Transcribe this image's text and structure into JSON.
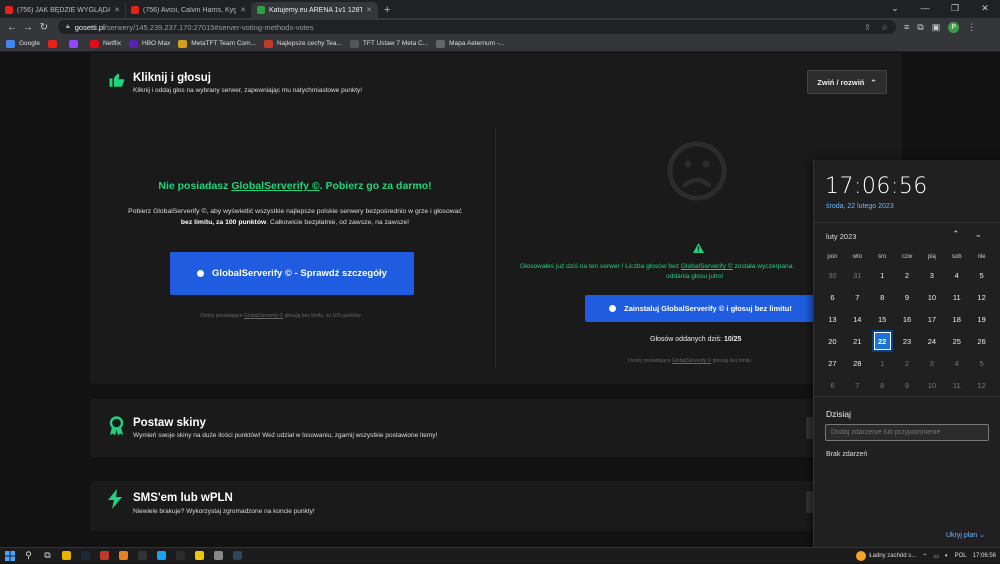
{
  "browser": {
    "tabs": [
      {
        "title": "(756) JAK BĘDZIE WYGLĄDAŁ M...",
        "icon_color": "#e62117",
        "active": false
      },
      {
        "title": "(756) Avicii, Calvin Harris, Kyg...",
        "icon_color": "#e62117",
        "active": false
      },
      {
        "title": "Katujemy.eu ARENA 1v1 128TR I...",
        "icon_color": "#2ea043",
        "active": true
      }
    ],
    "new_tab": "+",
    "window_controls": [
      "⌄",
      "—",
      "❐",
      "✕"
    ],
    "nav": {
      "back": "←",
      "forward": "→",
      "reload": "↻"
    },
    "url_host": "gosetti.pl",
    "url_path": "/serwery/145.239.237.170:27015#server-voting-methods-votes",
    "profile_letter": "P",
    "bookmarks": [
      {
        "label": "Google",
        "icon_color": "#4285f4"
      },
      {
        "label": "",
        "icon_color": "#e62117"
      },
      {
        "label": "",
        "icon_color": "#9146ff"
      },
      {
        "label": "Netflix",
        "icon_color": "#e50914"
      },
      {
        "label": "HBO Max",
        "icon_color": "#5822b4"
      },
      {
        "label": "MetaTFT Team Com...",
        "icon_color": "#d4a017"
      },
      {
        "label": "Najlepsze cechy Tea...",
        "icon_color": "#c0392b"
      },
      {
        "label": "TFT Ustaw 7 Meta C...",
        "icon_color": "#555"
      },
      {
        "label": "Mapa Aeternum -...",
        "icon_color": "#666"
      }
    ]
  },
  "vote_section": {
    "title": "Kliknij i głosuj",
    "subtitle": "Kliknij i oddaj głos na wybrany serwer, zapewniając mu natychmiastowe punkty!",
    "collapse_label": "Zwiń / rozwiń",
    "left": {
      "headline_pre": "Nie posiadasz ",
      "headline_link": "GlobalServerify ©",
      "headline_post": ". Pobierz go za darmo!",
      "desc_line1": "Pobierz GlobalServerify ©, aby wyświetlić wszystkie najlepsze polskie serwery bezpośrednio w grze i głosować",
      "desc_bold": "bez limitu, za 100 punktów",
      "desc_line2_post": ". Całkowicie bezpłatnie, od zawsze, na zawsze!",
      "button_label": "GlobalServerify © - Sprawdź szczegóły",
      "note_pre": "Osoby posiadające ",
      "note_link": "GlobalServerify ©",
      "note_post": " głosują bez limitu, za 100 punktów"
    },
    "right": {
      "message_line1_pre": "Głosowałeś już dziś na ten serwer / Liczba głosów bez ",
      "message_line1_link": "GlobalServerify ©",
      "message_line1_post": " została wyczerpana.",
      "message_line2": "oddania głosu jutro!",
      "button_label": "Zainstaluj GlobalServerify © i głosuj bez limitu!",
      "votes_label": "Głosów oddanych dziś: ",
      "votes_value": "10/25",
      "note_pre": "Osoby posiadające ",
      "note_link": "GlobalServerify ©",
      "note_post": " głosują bez limitu"
    }
  },
  "skins_section": {
    "title": "Postaw skiny",
    "subtitle": "Wymień swoje skiny na duże ilości punktów! Weź udział w losowaniu, zgarnij wszystkie postawione itemy!"
  },
  "sms_section": {
    "title": "SMS'em lub wPLN",
    "subtitle": "Niewiele brakuje? Wykorzystaj zgromadzone na koncie punkty!"
  },
  "calendar": {
    "time": "17:06:56",
    "date": "środa, 22 lutego 2023",
    "month": "luty 2023",
    "weekdays": [
      "pon",
      "wto",
      "śro",
      "czw",
      "pią",
      "sob",
      "nie"
    ],
    "weeks": [
      [
        {
          "d": "30",
          "dim": true
        },
        {
          "d": "31",
          "dim": true
        },
        {
          "d": "1"
        },
        {
          "d": "2"
        },
        {
          "d": "3"
        },
        {
          "d": "4"
        },
        {
          "d": "5"
        }
      ],
      [
        {
          "d": "6"
        },
        {
          "d": "7"
        },
        {
          "d": "8"
        },
        {
          "d": "9"
        },
        {
          "d": "10"
        },
        {
          "d": "11"
        },
        {
          "d": "12"
        }
      ],
      [
        {
          "d": "13"
        },
        {
          "d": "14"
        },
        {
          "d": "15"
        },
        {
          "d": "16"
        },
        {
          "d": "17"
        },
        {
          "d": "18"
        },
        {
          "d": "19"
        }
      ],
      [
        {
          "d": "20"
        },
        {
          "d": "21"
        },
        {
          "d": "22",
          "today": true
        },
        {
          "d": "23"
        },
        {
          "d": "24"
        },
        {
          "d": "25"
        },
        {
          "d": "26"
        }
      ],
      [
        {
          "d": "27"
        },
        {
          "d": "28"
        },
        {
          "d": "1",
          "dim": true
        },
        {
          "d": "2",
          "dim": true
        },
        {
          "d": "3",
          "dim": true
        },
        {
          "d": "4",
          "dim": true
        },
        {
          "d": "5",
          "dim": true
        }
      ],
      [
        {
          "d": "6",
          "dim": true
        },
        {
          "d": "7",
          "dim": true
        },
        {
          "d": "8",
          "dim": true
        },
        {
          "d": "9",
          "dim": true
        },
        {
          "d": "10",
          "dim": true
        },
        {
          "d": "11",
          "dim": true
        },
        {
          "d": "12",
          "dim": true
        }
      ]
    ],
    "today_header": "Dzisiaj",
    "event_placeholder": "Dodaj zdarzenie lub przypomnienie",
    "no_events": "Brak zdarzeń",
    "hide_plan": "Ukryj plan"
  },
  "taskbar": {
    "apps": [
      {
        "name": "start-icon",
        "color": "#4aa3ff"
      },
      {
        "name": "search-icon",
        "color": "#ddd"
      },
      {
        "name": "task-view-icon",
        "color": "#ddd"
      },
      {
        "name": "chrome-icon",
        "color": "#e8b100"
      },
      {
        "name": "steam-icon",
        "color": "#1b2838"
      },
      {
        "name": "app-red-icon",
        "color": "#c0392b"
      },
      {
        "name": "app-orange-icon",
        "color": "#e67e22"
      },
      {
        "name": "app-blank-icon",
        "color": "#333"
      },
      {
        "name": "edge-icon",
        "color": "#1da1f2"
      },
      {
        "name": "app-dark-icon",
        "color": "#2b2b2b"
      },
      {
        "name": "explorer-icon",
        "color": "#f1c40f"
      },
      {
        "name": "app-grid-icon",
        "color": "#888"
      },
      {
        "name": "steam2-icon",
        "color": "#2a475e"
      }
    ],
    "weather": "Ładny zachód s...",
    "lang": "POL",
    "time": "17:06:56"
  }
}
